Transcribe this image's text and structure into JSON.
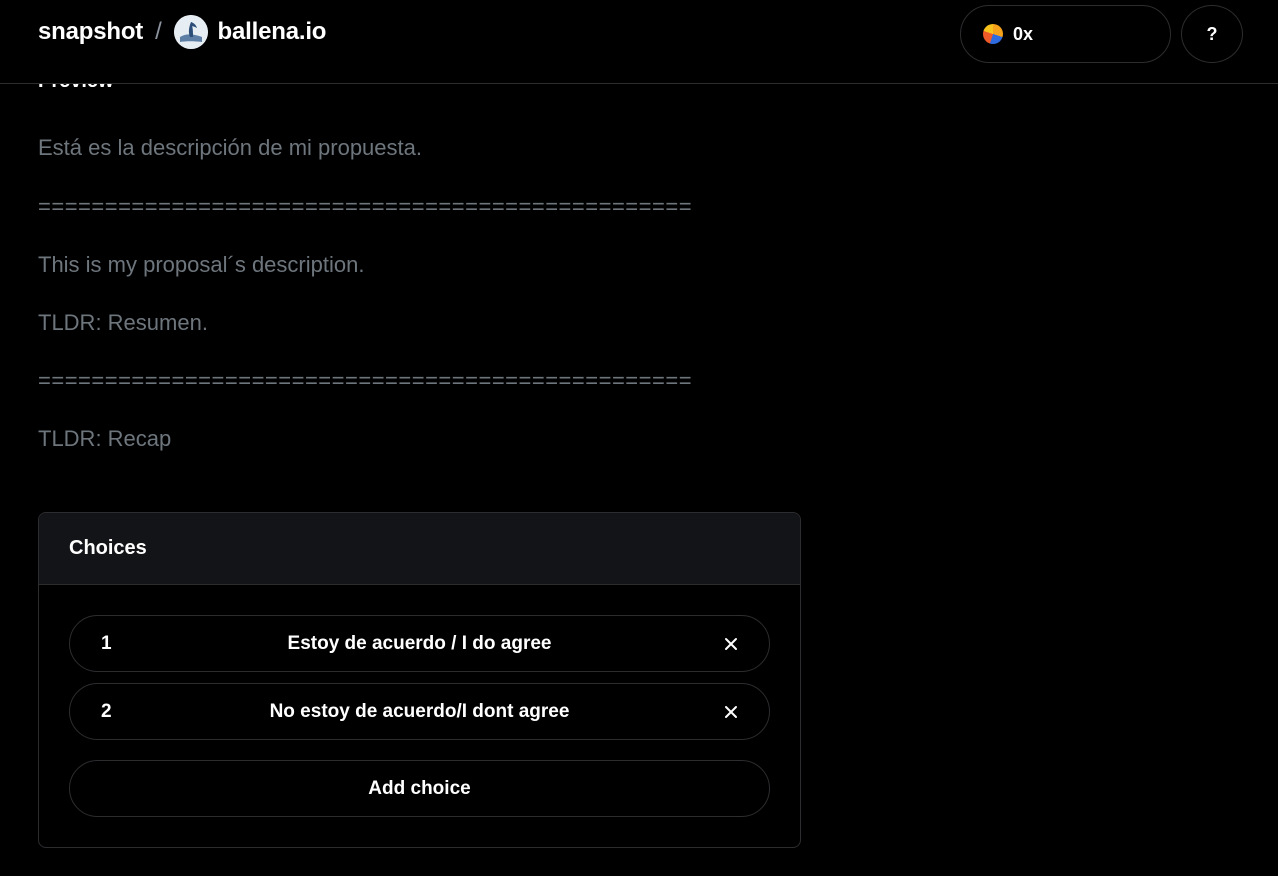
{
  "header": {
    "brand": "snapshot",
    "separator": "/",
    "space_name": "ballena.io",
    "wallet_label": "0x",
    "help_label": "?"
  },
  "preview": {
    "label": "Preview",
    "lines": [
      "Está es la descripción de mi propuesta.",
      "=================================================",
      "This is my proposal´s description.",
      "TLDR: Resumen.",
      "=================================================",
      "TLDR: Recap"
    ]
  },
  "choices": {
    "title": "Choices",
    "items": [
      {
        "number": "1",
        "text": "Estoy de acuerdo / I do agree"
      },
      {
        "number": "2",
        "text": "No estoy de acuerdo/I dont agree"
      }
    ],
    "add_label": "Add choice"
  },
  "colors": {
    "background": "#000000",
    "border": "#2d2d30",
    "muted_text": "#6e767d",
    "header_panel": "#131417"
  }
}
